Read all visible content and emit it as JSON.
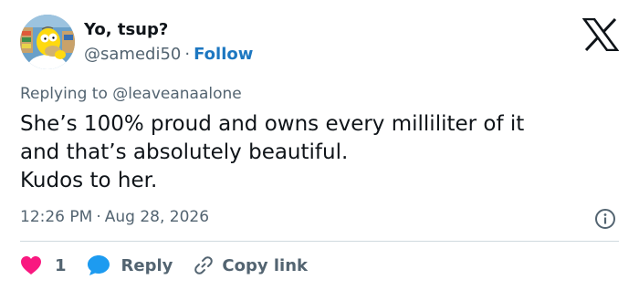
{
  "tweet": {
    "display_name": "Yo, tsup?",
    "handle": "@samedi50",
    "separator": "·",
    "follow_label": "Follow",
    "replying_prefix": "Replying to",
    "replying_to": "@leaveanaalone",
    "text_lines": [
      "She’s 100% proud and owns every milliliter of it",
      "and that’s absolutely beautiful.",
      "Kudos to her."
    ],
    "time": "12:26 PM",
    "date": "Aug 28, 2026",
    "like_count": "1",
    "reply_label": "Reply",
    "copy_link_label": "Copy link"
  },
  "icons": {
    "platform_logo": "x-logo-icon",
    "info": "info-icon",
    "like": "heart-icon",
    "reply": "speech-bubble-icon",
    "copy_link": "link-icon"
  },
  "colors": {
    "text_primary": "#0f1419",
    "text_secondary": "#536471",
    "follow": "#1d77c1",
    "heart": "#f91880",
    "reply_bubble": "#1d9bf0",
    "divider": "#cfd9de"
  }
}
